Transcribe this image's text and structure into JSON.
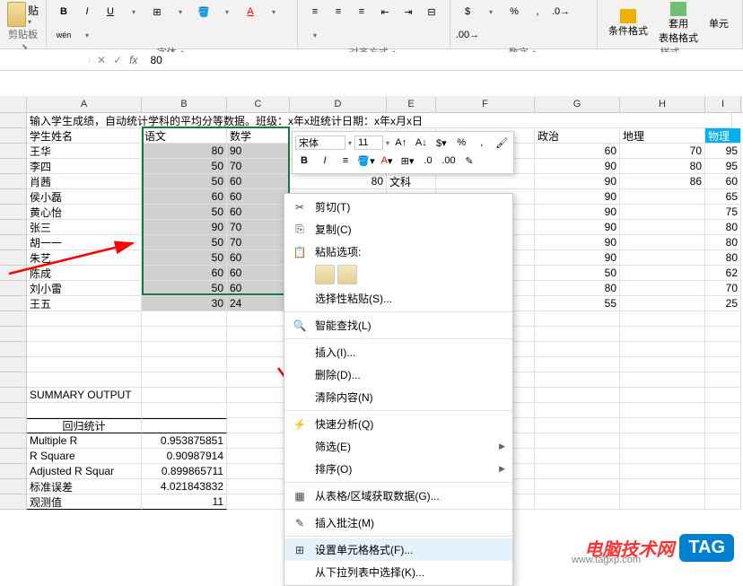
{
  "ribbon": {
    "groups": {
      "clipboard": {
        "label": "剪贴板",
        "paste": "贴"
      },
      "font": {
        "label": "字体"
      },
      "alignment": {
        "label": "对齐方式"
      },
      "number": {
        "label": "数字"
      },
      "styles": {
        "label": "样式",
        "conditional": "条件格式",
        "table": "套用\n表格格式",
        "cell": "单元"
      }
    }
  },
  "formula_bar": {
    "cell_ref": "",
    "fx": "fx",
    "value": "80"
  },
  "columns": [
    "A",
    "B",
    "C",
    "D",
    "E",
    "F",
    "G",
    "H",
    "I"
  ],
  "title_row": "输入学生成绩，自动统计学科的平均分等数据。班级：x年x班统计日期：x年x月x日",
  "headers": {
    "name": "学生姓名",
    "chinese": "语文",
    "math": "数学",
    "politics": "政治",
    "geography": "地理",
    "physics": "物理"
  },
  "students": [
    {
      "name": "王华",
      "ch": 80,
      "ma": 90,
      "po": 60,
      "ge": 70,
      "ph": 95
    },
    {
      "name": "李四",
      "ch": 50,
      "ma": 70,
      "po": 90,
      "ge": 80,
      "ph": 95
    },
    {
      "name": "肖茜",
      "ch": 50,
      "ma": 60,
      "po": 90,
      "ge": 86,
      "ph": 60
    },
    {
      "name": "侯小磊",
      "ch": 60,
      "ma": 60,
      "po": 90,
      "ge": "",
      "ph": 65
    },
    {
      "name": "黄心怡",
      "ch": 50,
      "ma": 60,
      "po": 90,
      "ge": "",
      "ph": 75
    },
    {
      "name": "张三",
      "ch": 90,
      "ma": 70,
      "po": 90,
      "ge": "",
      "ph": 80
    },
    {
      "name": "胡一一",
      "ch": 50,
      "ma": 70,
      "po": 90,
      "ge": "",
      "ph": 80
    },
    {
      "name": "朱艺",
      "ch": 50,
      "ma": 60,
      "po": 90,
      "ge": "",
      "ph": 80
    },
    {
      "name": "陈成",
      "ch": 60,
      "ma": 60,
      "po": 50,
      "ge": "",
      "ph": 62
    },
    {
      "name": "刘小雷",
      "ch": 50,
      "ma": 60,
      "po": 80,
      "ge": "",
      "ph": 70
    },
    {
      "name": "王五",
      "ch": 30,
      "ma": 24,
      "po": 55,
      "ge": "",
      "ph": 25
    }
  ],
  "ext_row": {
    "d": "80",
    "e": "文科"
  },
  "summary_label": "SUMMARY OUTPUT",
  "regression_header": "回归统计",
  "regression": [
    {
      "k": "Multiple R",
      "v": "0.953875851"
    },
    {
      "k": "R Square",
      "v": "0.90987914"
    },
    {
      "k": "Adjusted R Squar",
      "v": "0.899865711"
    },
    {
      "k": "标准误差",
      "v": "4.021843832"
    },
    {
      "k": "观测值",
      "v": "11"
    }
  ],
  "mini_toolbar": {
    "font": "宋体",
    "size": "11"
  },
  "context_menu": [
    {
      "icon": "✂",
      "label": "剪切(T)"
    },
    {
      "icon": "⎘",
      "label": "复制(C)"
    },
    {
      "icon": "📋",
      "label": "粘贴选项:",
      "is_paste_header": true
    },
    {
      "icon": "",
      "label": "选择性粘贴(S)..."
    },
    {
      "icon": "🔍",
      "label": "智能查找(L)",
      "sep_before": true
    },
    {
      "icon": "",
      "label": "插入(I)...",
      "sep_before": true
    },
    {
      "icon": "",
      "label": "删除(D)..."
    },
    {
      "icon": "",
      "label": "清除内容(N)"
    },
    {
      "icon": "⚡",
      "label": "快速分析(Q)",
      "sep_before": true
    },
    {
      "icon": "",
      "label": "筛选(E)",
      "arrow": true
    },
    {
      "icon": "",
      "label": "排序(O)",
      "arrow": true
    },
    {
      "icon": "▦",
      "label": "从表格/区域获取数据(G)...",
      "sep_before": true
    },
    {
      "icon": "✎",
      "label": "插入批注(M)",
      "sep_before": true
    },
    {
      "icon": "⊞",
      "label": "设置单元格格式(F)...",
      "highlight": true,
      "sep_before": true
    },
    {
      "icon": "",
      "label": "从下拉列表中选择(K)..."
    }
  ],
  "watermark": {
    "text": "电脑技术网",
    "tag": "TAG",
    "url": "www.tagxp.com"
  }
}
